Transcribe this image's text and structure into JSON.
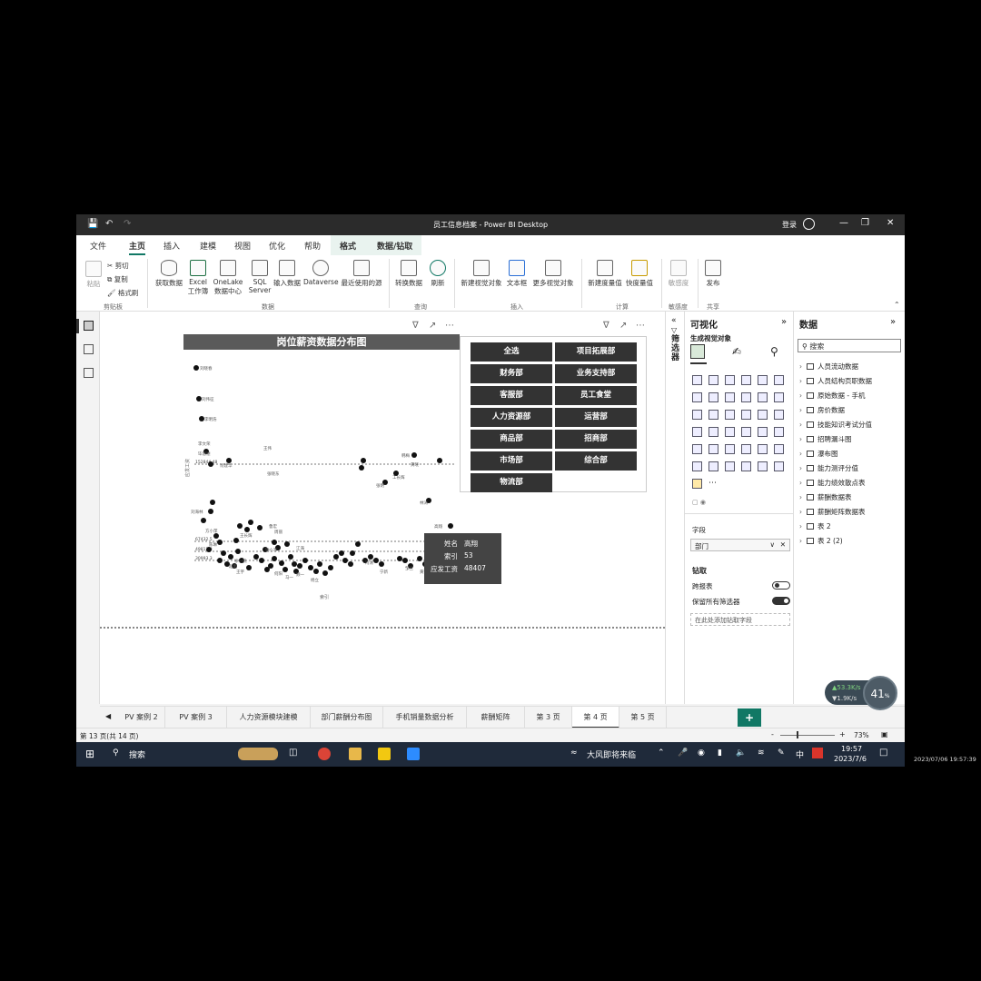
{
  "window": {
    "title": "员工信息档案 - Power BI Desktop",
    "signin": "登录"
  },
  "menu": {
    "tabs": [
      "文件",
      "主页",
      "插入",
      "建模",
      "视图",
      "优化",
      "帮助",
      "格式",
      "数据/钻取"
    ],
    "active": "主页"
  },
  "ribbon": {
    "paste": "粘贴",
    "cut": "剪切",
    "copy": "复制",
    "format_painter": "格式刷",
    "clipboard_group": "剪贴板",
    "get_data": "获取数据",
    "excel_l1": "Excel",
    "excel_l2": "工作簿",
    "onelake_l1": "OneLake",
    "onelake_l2": "数据中心",
    "sql_l1": "SQL",
    "sql_l2": "Server",
    "enter_data": "输入数据",
    "dataverse": "Dataverse",
    "recent_sources": "最近使用的源",
    "data_group": "数据",
    "transform": "转换数据",
    "refresh": "刷新",
    "query_group": "查询",
    "new_visual": "新建视觉对象",
    "text_box": "文本框",
    "more_visuals": "更多视觉对象",
    "insert_group": "插入",
    "new_measure": "新建度量值",
    "quick_measure": "快度量值",
    "calc_group": "计算",
    "sensitivity": "敏感度",
    "sensitivity_group": "敏感度",
    "publish": "发布",
    "share_group": "共享"
  },
  "chart_data": {
    "type": "scatter",
    "title": "岗位薪资数据分布图",
    "xlabel": "索引",
    "ylabel": "应发工资",
    "reference_lines": [
      "152844.48",
      "67432.5",
      "49813.8",
      "30993.3"
    ],
    "point_labels": [
      "刘晓春",
      "刘伟征",
      "李明浩",
      "李文荣",
      "毕思德",
      "肖建华",
      "王伟",
      "张晓东",
      "刘海林",
      "方小萍",
      "陈琳",
      "赵明",
      "周丽",
      "徐一帆",
      "王长辉",
      "钟小军",
      "江海",
      "韩梅",
      "黄晓",
      "张明",
      "工长辉",
      "林涛",
      "高翔",
      "刘华",
      "鲁宏",
      "王宇",
      "顾一",
      "冯清",
      "宁新",
      "邹兰",
      "黄宇",
      "吕一楠",
      "何阳",
      "马一",
      "杨立"
    ],
    "tooltip": {
      "name_key": "姓名",
      "name_value": "高翔",
      "index_key": "索引",
      "index_value": "53",
      "salary_key": "应发工资",
      "salary_value": "48407"
    }
  },
  "slicer": {
    "items": [
      "全选",
      "项目拓展部",
      "财务部",
      "业务支持部",
      "客服部",
      "员工食堂",
      "人力资源部",
      "运营部",
      "商品部",
      "招商部",
      "市场部",
      "综合部",
      "物流部"
    ]
  },
  "filters_label": "筛选器",
  "viz_pane": {
    "title": "可视化",
    "build_label": "生成视觉对象",
    "fields_label": "字段",
    "field_value": "部门",
    "drill_title": "钻取",
    "cross_report": "跨报表",
    "keep_filters": "保留所有筛选器",
    "add_drill_placeholder": "在此处添加钻取字段",
    "r_visual": "R",
    "py_visual": "Py"
  },
  "data_pane": {
    "title": "数据",
    "search_placeholder": "搜索",
    "tables": [
      "人员流动数据",
      "人员结构页职数据",
      "原始数据 - 手机",
      "房价数据",
      "技能知识考试分值",
      "招聘漏斗图",
      "瀑布图",
      "能力测评分值",
      "能力绩效散点表",
      "薪酬数据表",
      "薪酬矩阵数据表",
      "表 2",
      "表 2 (2)"
    ]
  },
  "pages": {
    "tabs": [
      "PV 案例 2",
      "PV 案例 3",
      "人力资源模块建模",
      "部门薪酬分布图",
      "手机销量数据分析",
      "薪酬矩阵",
      "第 3 页",
      "第 4 页",
      "第 5 页"
    ],
    "active": "第 4 页",
    "add": "+"
  },
  "status": {
    "page_info": "第 13 页(共 14 页)",
    "zoom": "73%"
  },
  "taskbar": {
    "search": "搜索",
    "weather": "大风即将来临",
    "ime": "中",
    "time": "19:57",
    "date": "2023/7/6"
  },
  "net_widget": {
    "up": "53.3",
    "up_unit": "K/s",
    "down": "1.9",
    "down_unit": "K/s",
    "percent": "41",
    "percent_unit": "%"
  },
  "outer_timestamp": "2023/07/06 19:57:39"
}
